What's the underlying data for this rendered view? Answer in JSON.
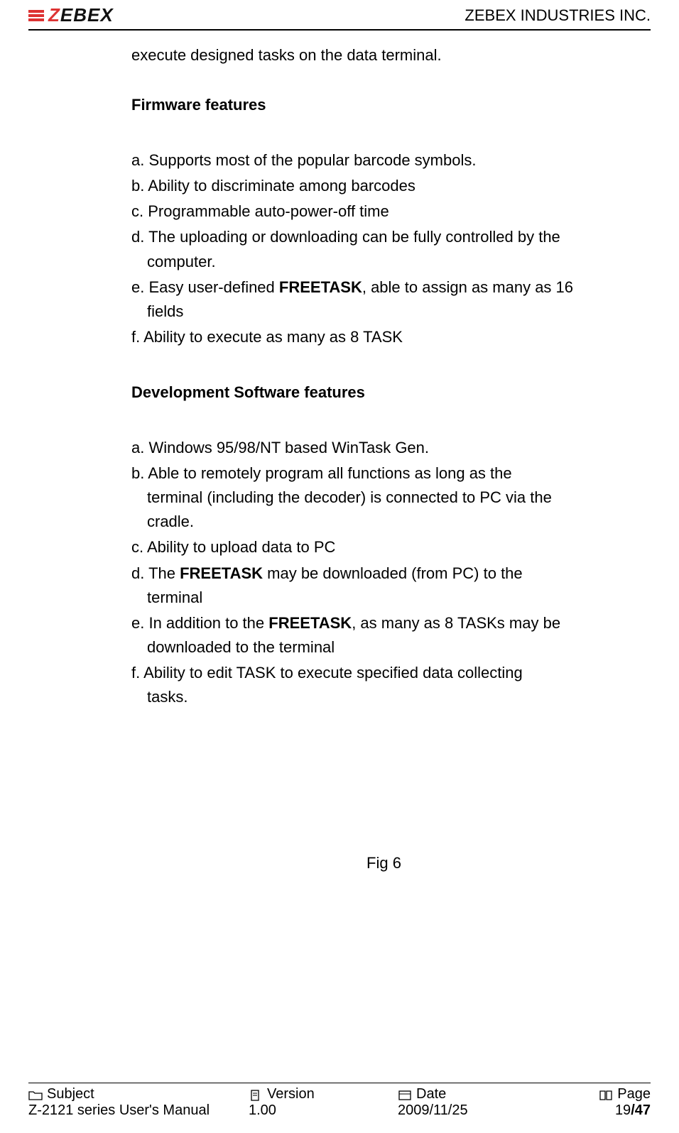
{
  "header": {
    "logo_part1": "Z",
    "logo_part2": "EBEX",
    "company": "ZEBEX INDUSTRIES INC."
  },
  "content": {
    "lead": "execute designed tasks on the data terminal.",
    "firmware_heading": "Firmware features",
    "firmware": {
      "a": "a. Supports most of the popular barcode symbols.",
      "b": "b. Ability to discriminate among barcodes",
      "c": "c. Programmable auto-power-off time",
      "d1": "d. The uploading or downloading can be fully controlled by the",
      "d2": "computer.",
      "e1_pre": "e. Easy user-defined ",
      "e1_bold": "FREETASK",
      "e1_post": ", able to assign as many as 16",
      "e2": "fields",
      "f": "f. Ability to execute as many as 8 TASK"
    },
    "devsoft_heading": "Development Software features",
    "devsoft": {
      "a": "a. Windows 95/98/NT based WinTask Gen.",
      "b1": "b. Able to remotely program all functions as long as the",
      "b2": "terminal (including the decoder) is connected to PC via the",
      "b3": "cradle.",
      "c": "c. Ability   to upload data to PC",
      "d1_pre": "d. The ",
      "d1_bold": "FREETASK",
      "d1_post": " may be downloaded (from PC) to the",
      "d2": "terminal",
      "e1_pre": "e. In addition to the ",
      "e1_bold": "FREETASK",
      "e1_post": ", as many as 8 TASKs may be",
      "e2": "downloaded to the terminal",
      "f1": "f. Ability to edit TASK to execute specified data collecting",
      "f2": "tasks."
    },
    "figure": "Fig 6"
  },
  "footer": {
    "labels": {
      "subject": "Subject",
      "version": "Version",
      "date": "Date",
      "page": "Page"
    },
    "values": {
      "subject": "Z-2121 series User's Manual",
      "version": "1.00",
      "date": "2009/11/25",
      "page_current": "19",
      "page_sep": " / ",
      "page_total": "47"
    }
  }
}
